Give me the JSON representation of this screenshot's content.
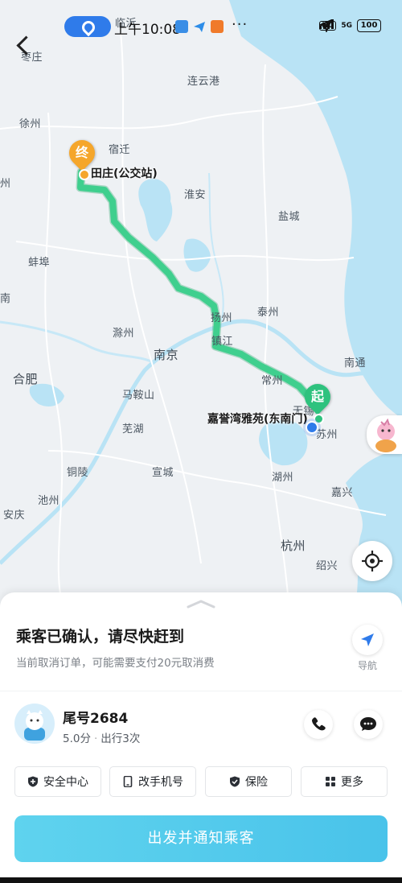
{
  "status_bar": {
    "time": "上午10:08",
    "network": "5G",
    "hd_label": "HD",
    "battery": "100",
    "more": "···"
  },
  "map": {
    "cities": [
      "临沂",
      "枣庄",
      "连云港",
      "徐州",
      "宿迁",
      "淮安",
      "盐城",
      "蚌埠",
      "扬州",
      "泰州",
      "滁州",
      "南京",
      "镇江",
      "合肥",
      "马鞍山",
      "常州",
      "南通",
      "芜湖",
      "无锡",
      "苏州",
      "铜陵",
      "宣城",
      "湖州",
      "池州",
      "嘉兴",
      "安庆",
      "杭州",
      "绍兴"
    ],
    "edge_fragments": [
      "州",
      "南"
    ],
    "route_colors": {
      "route": "#3fcf8e",
      "end_marker": "#f5a62b",
      "start_marker": "#2ec27e",
      "driver": "#2f7bea"
    },
    "end_marker_text": "终",
    "end_label": "田庄(公交站)",
    "start_marker_text": "起",
    "start_label": "嘉誉湾雅苑(东南门)"
  },
  "sheet": {
    "title": "乘客已确认，请尽快赶到",
    "subtitle": "当前取消订单，可能需要支付20元取消费",
    "nav_label": "导航",
    "passenger": {
      "tail": "尾号2684",
      "score": "5.0分",
      "trips": "出行3次"
    },
    "quick_actions": [
      {
        "label": "安全中心",
        "icon": "shield-plus-icon"
      },
      {
        "label": "改手机号",
        "icon": "phone-device-icon"
      },
      {
        "label": "保险",
        "icon": "shield-check-icon"
      },
      {
        "label": "更多",
        "icon": "grid-icon"
      }
    ],
    "cta": "出发并通知乘客"
  }
}
